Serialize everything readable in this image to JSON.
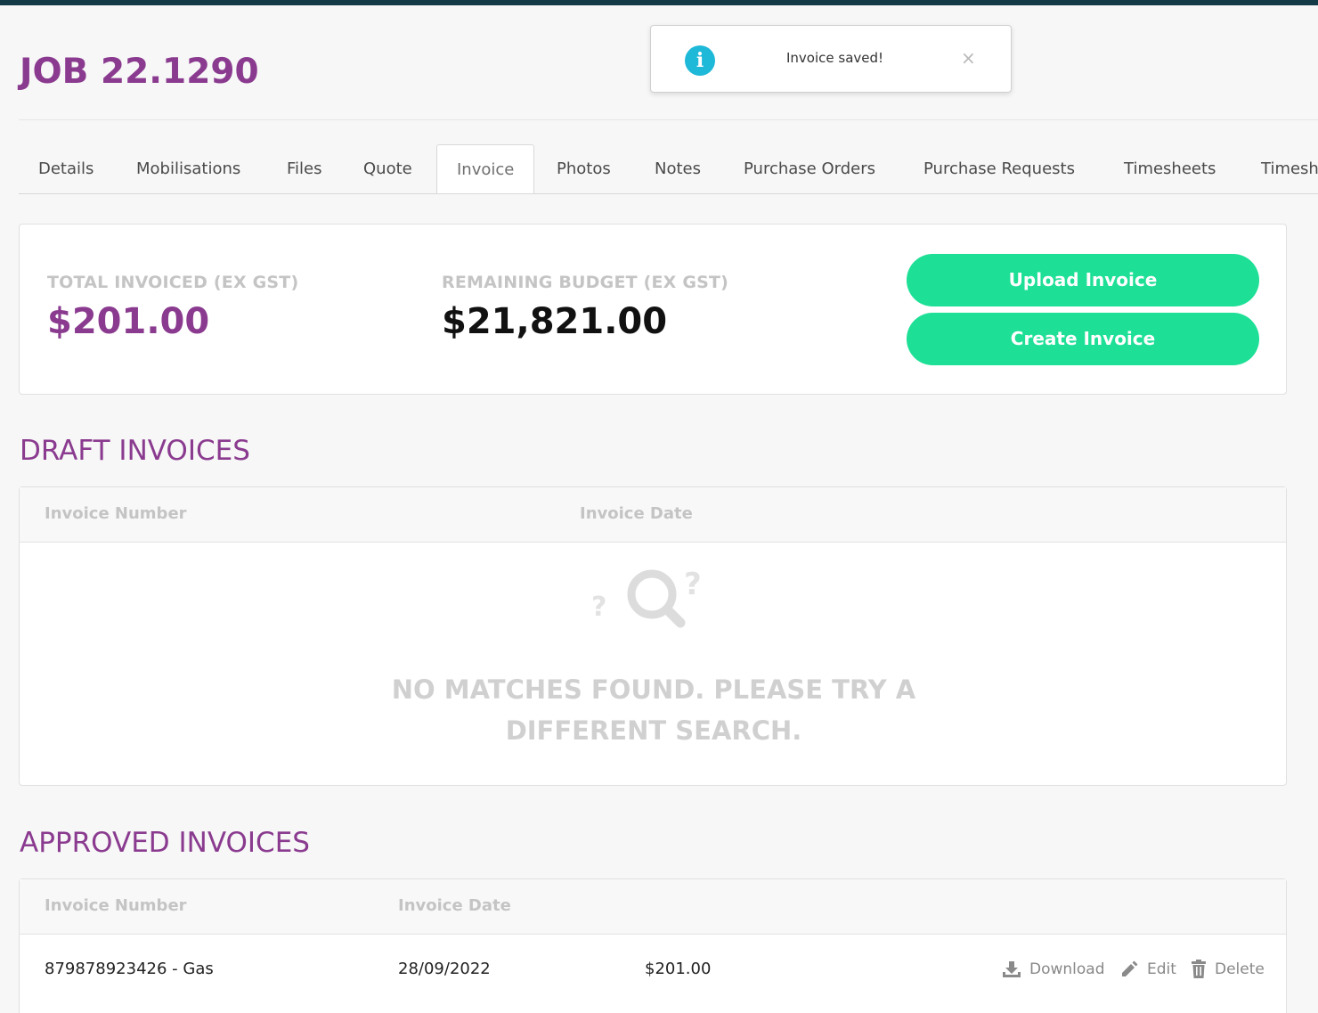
{
  "job": {
    "title": "JOB 22.1290"
  },
  "toast": {
    "message": "Invoice saved!",
    "close_glyph": "×"
  },
  "tabs": [
    {
      "label": "Details"
    },
    {
      "label": "Mobilisations"
    },
    {
      "label": "Files"
    },
    {
      "label": "Quote"
    },
    {
      "label": "Invoice",
      "active": true
    },
    {
      "label": "Photos"
    },
    {
      "label": "Notes"
    },
    {
      "label": "Purchase Orders"
    },
    {
      "label": "Purchase Requests"
    },
    {
      "label": "Timesheets"
    },
    {
      "label": "Timesh"
    }
  ],
  "summary": {
    "total_invoiced_label": "TOTAL INVOICED (EX GST)",
    "total_invoiced_value": "$201.00",
    "remaining_budget_label": "REMAINING BUDGET (EX GST)",
    "remaining_budget_value": "$21,821.00",
    "upload_button": "Upload Invoice",
    "create_button": "Create Invoice"
  },
  "draft": {
    "title": "DRAFT INVOICES",
    "columns": [
      "Invoice Number",
      "Invoice Date"
    ],
    "empty_line1": "NO MATCHES FOUND. PLEASE TRY A",
    "empty_line2": "DIFFERENT SEARCH."
  },
  "approved": {
    "title": "APPROVED INVOICES",
    "columns": [
      "Invoice Number",
      "Invoice Date"
    ],
    "rows": [
      {
        "number": "879878923426 - Gas",
        "date": "28/09/2022",
        "amount": "$201.00",
        "actions": {
          "download": "Download",
          "edit": "Edit",
          "delete": "Delete"
        }
      }
    ]
  },
  "colors": {
    "brand_purple": "#8a3b8f",
    "accent_green": "#1ddf96",
    "topbar": "#143a47",
    "info_blue": "#1eb8d8"
  },
  "icons": [
    "info-icon",
    "close-icon",
    "no-results-icon",
    "download-icon",
    "edit-icon",
    "delete-icon"
  ]
}
